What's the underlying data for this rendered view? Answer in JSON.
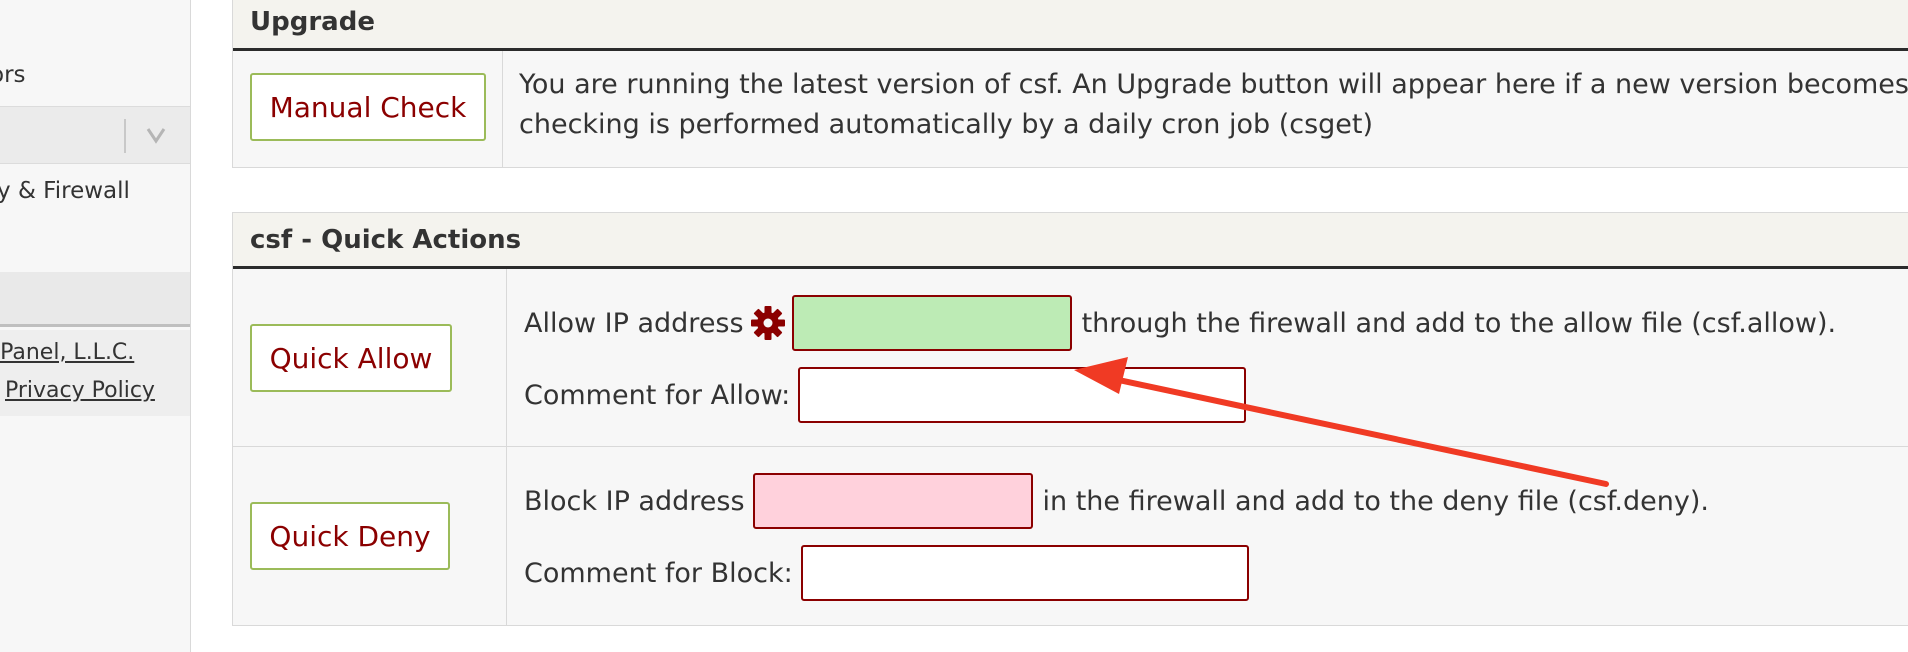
{
  "sidebar": {
    "item_partial_1": "ors",
    "item_partial_2": "ty & Firewall",
    "footer_link_company": "cPanel, L.L.C.",
    "footer_link_privacy": "Privacy Policy"
  },
  "upgrade": {
    "title": "Upgrade",
    "button_label": "Manual Check",
    "text_line1": "You are running the latest version of csf. An Upgrade button will appear here if a new version becomes ava",
    "text_line2": "checking is performed automatically by a daily cron job (csget)"
  },
  "quick_actions": {
    "title": "csf - Quick Actions",
    "allow": {
      "button_label": "Quick Allow",
      "ip_label": "Allow IP address",
      "ip_value": "",
      "after_text": "through the firewall and add to the allow file (csf.allow).",
      "comment_label": "Comment for Allow:",
      "comment_value": ""
    },
    "deny": {
      "button_label": "Quick Deny",
      "ip_label": "Block IP address",
      "ip_value": "",
      "after_text": "in the firewall and add to the deny file (csf.deny).",
      "comment_label": "Comment for Block:",
      "comment_value": ""
    }
  },
  "colors": {
    "button_text": "#8b0000",
    "button_border": "#9bbb59",
    "allow_input_bg": "#bdebb5",
    "deny_input_bg": "#ffd1dc",
    "annotation_arrow": "#f03a24"
  },
  "icons": {
    "gear": "gear-icon",
    "chevron": "chevron-down-icon",
    "arrow": "annotation-arrow"
  }
}
